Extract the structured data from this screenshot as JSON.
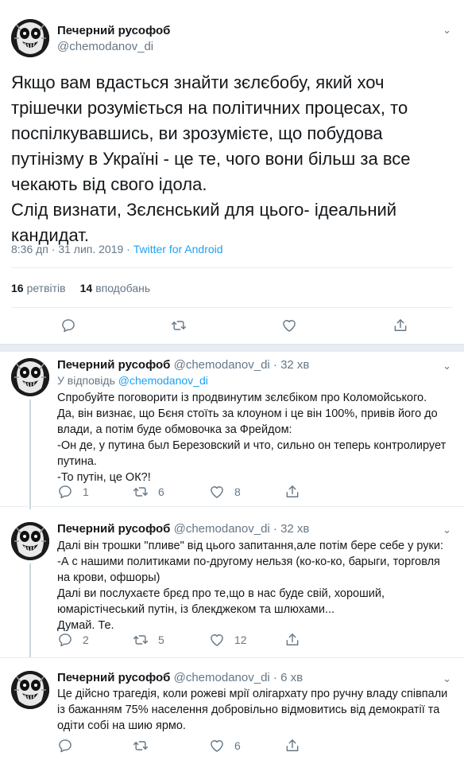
{
  "main": {
    "name": "Печерний русофоб",
    "handle": "@chemodanov_di",
    "text": "Якщо вам вдасться знайти зєлєбобу, який хоч трішечки розуміється на політичних процесах, то поспілкувавшись, ви зрозумієте, що побудова путінізму в Україні - це те, чого вони більш за все чекають від свого ідола.\nСлід визнати, Зєлєнський для цього- ідеальний кандидат.",
    "time": "8:36 дп · 31 лип. 2019 · ",
    "source": "Twitter for Android",
    "retweets_count": "16",
    "retweets_label": "ретвітів",
    "likes_count": "14",
    "likes_label": "вподобань"
  },
  "replies": [
    {
      "name": "Печерний русофоб",
      "handle": "@chemodanov_di · 32 хв",
      "reply_prefix": "У відповідь ",
      "reply_to": "@chemodanov_di",
      "text": "Спробуйте поговорити із продвинутим зєлєбіком про Коломойського.\nДа, він визнає, що Бєня стоїть за клоуном і це він 100%, привів його до влади, а потім буде обмовочка за Фрейдом:\n-Он де, у путина был Березовский и что, сильно он теперь контролирует путина.\n-То путін, це ОК?!",
      "replies": "1",
      "retweets": "6",
      "likes": "8"
    },
    {
      "name": "Печерний русофоб",
      "handle": "@chemodanov_di · 32 хв",
      "text": "Далі він трошки \"пливе\" від цього запитання,але потім бере себе у руки:\n-А с нашими политиками по-другому нельзя (ко-ко-ко, барыги, торговля на крови, офшоры)\nДалі ви послухаєте брєд про те,що в нас буде свій, хороший, юмарістічеський путін, із блекджеком та шлюхами...\nДумай. Те.",
      "replies": "2",
      "retweets": "5",
      "likes": "12"
    },
    {
      "name": "Печерний русофоб",
      "handle": "@chemodanov_di · 6 хв",
      "text": "Це дійсно трагедія, коли рожеві мрії олігархату про ручну владу співпали із бажанням 75% населення добровільно відмовитись від демократії та одіти собі на шию ярмо.",
      "replies": "",
      "retweets": "",
      "likes": "6"
    }
  ],
  "icons": {
    "reply": "reply-icon",
    "retweet": "retweet-icon",
    "like": "heart-icon",
    "share": "share-icon",
    "more": "chevron-down-icon"
  },
  "colors": {
    "link": "#1da1f2",
    "muted": "#657786",
    "text": "#14171a",
    "divider": "#e6ecf0"
  }
}
